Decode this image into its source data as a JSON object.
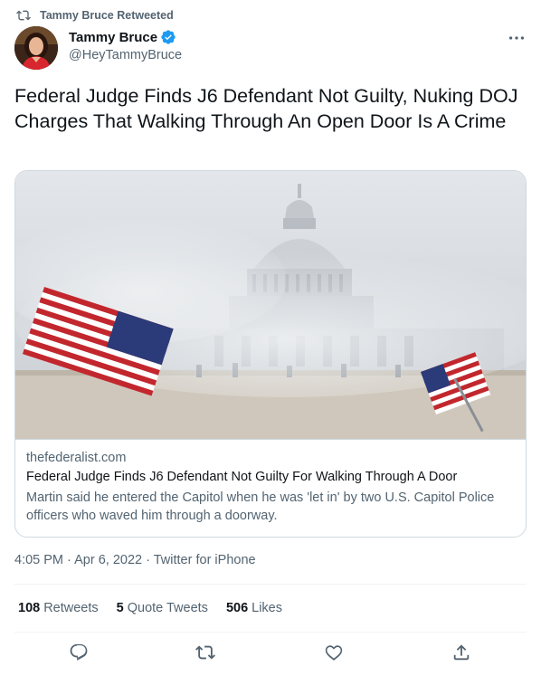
{
  "retweet": {
    "label": "Tammy Bruce Retweeted",
    "icon": "retweet-icon"
  },
  "author": {
    "name": "Tammy Bruce",
    "handle": "@HeyTammyBruce",
    "verified_color": "#1d9bf0"
  },
  "tweet": {
    "text": "Federal Judge Finds J6 Defendant Not Guilty, Nuking DOJ Charges That Walking Through An Open Door Is A Crime"
  },
  "card": {
    "domain": "thefederalist.com",
    "title": "Federal Judge Finds J6 Defendant Not Guilty For Walking Through A Door",
    "description": "Martin said he entered the Capitol when he was 'let in' by two U.S. Capitol Police officers who waved him through a doorway."
  },
  "meta": {
    "time": "4:05 PM",
    "separator": "·",
    "date": "Apr 6, 2022",
    "source": "Twitter for iPhone"
  },
  "stats": {
    "retweets_count": "108",
    "retweets_label": "Retweets",
    "quotes_count": "5",
    "quotes_label": "Quote Tweets",
    "likes_count": "506",
    "likes_label": "Likes"
  },
  "colors": {
    "text": "#0f1419",
    "secondary": "#536471",
    "border": "#cfd9de",
    "accent": "#1d9bf0"
  },
  "actions": [
    "reply-icon",
    "retweet-icon",
    "like-icon",
    "share-icon"
  ]
}
